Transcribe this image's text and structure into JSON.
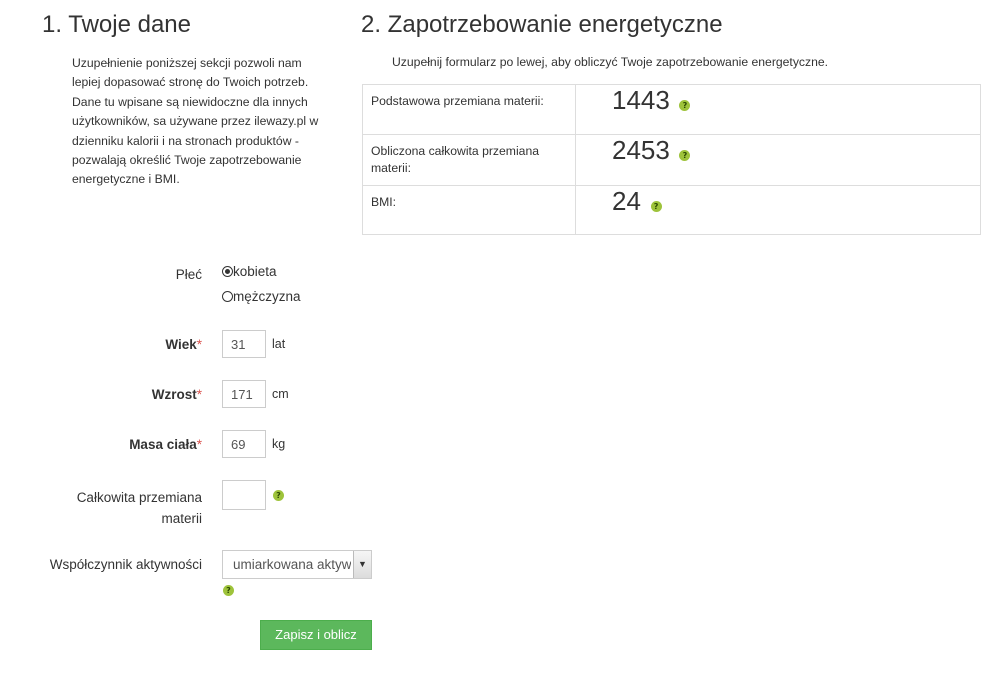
{
  "left": {
    "title": "1. Twoje dane",
    "intro": "Uzupełnienie poniższej sekcji pozwoli nam lepiej dopasować stronę do Twoich potrzeb. Dane tu wpisane są niewidoczne dla innych użytkowników, sa używane przez ilewazy.pl w dzienniku kalorii i na stronach produktów - pozwalają określić Twoje zapotrzebowanie energetyczne i BMI."
  },
  "right": {
    "title": "2. Zapotrzebowanie energetyczne",
    "hint": "Uzupełnij formularz po lewej, aby obliczyć Twoje zapotrzebowanie energetyczne.",
    "rows": [
      {
        "label": "Podstawowa przemiana materii:",
        "value": "1443"
      },
      {
        "label": "Obliczona całkowita przemiana materii:",
        "value": "2453"
      },
      {
        "label": "BMI:",
        "value": "24"
      }
    ]
  },
  "form": {
    "sex_label": "Płeć",
    "sex_options": [
      {
        "label": "kobieta",
        "checked": true
      },
      {
        "label": "mężczyzna",
        "checked": false
      }
    ],
    "age_label": "Wiek",
    "age_value": "31",
    "age_unit": "lat",
    "height_label": "Wzrost",
    "height_value": "171",
    "height_unit": "cm",
    "weight_label": "Masa ciała",
    "weight_value": "69",
    "weight_unit": "kg",
    "required_mark": "*",
    "total_label_line1": "Całkowita przemiana",
    "total_label_line2": "materii",
    "total_value": "",
    "activity_label": "Współczynnik aktywności",
    "activity_selected": "umiarkowana aktywność",
    "help_glyph": "?",
    "submit_label": "Zapisz i oblicz"
  },
  "colors": {
    "accent_green": "#5cb85c",
    "help_green": "#9ec33b",
    "required_red": "#d9534f"
  }
}
